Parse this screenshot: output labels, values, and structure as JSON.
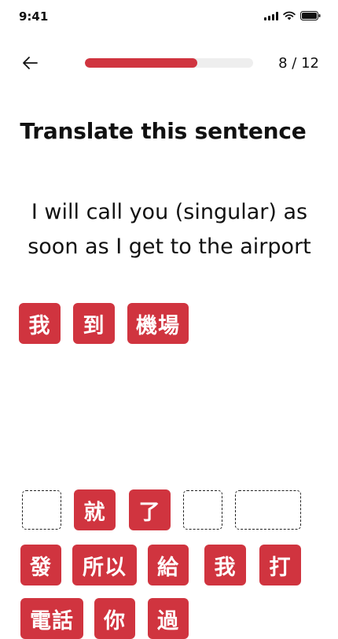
{
  "status_bar": {
    "time": "9:41",
    "icons": [
      "signal-icon",
      "wifi-icon",
      "battery-icon"
    ]
  },
  "header": {
    "back_icon": "arrow-left-icon",
    "progress_current": 8,
    "progress_total": 12,
    "progress_text": "8 / 12"
  },
  "instruction": "Translate this sentence",
  "sentence": "I will call you (singular) as soon as I get to the airport",
  "answer_tiles": [
    "我",
    "到",
    "機場"
  ],
  "word_bank": {
    "row1": [
      {
        "type": "slot"
      },
      {
        "type": "tile",
        "text": "就"
      },
      {
        "type": "tile",
        "text": "了"
      },
      {
        "type": "slot"
      },
      {
        "type": "slot"
      }
    ],
    "row2": [
      "發",
      "所以",
      "給",
      "我",
      "打"
    ],
    "row3": [
      "電話",
      "你",
      "過"
    ]
  },
  "colors": {
    "accent": "#d0343f",
    "track": "#eeeeee",
    "text": "#111111"
  }
}
